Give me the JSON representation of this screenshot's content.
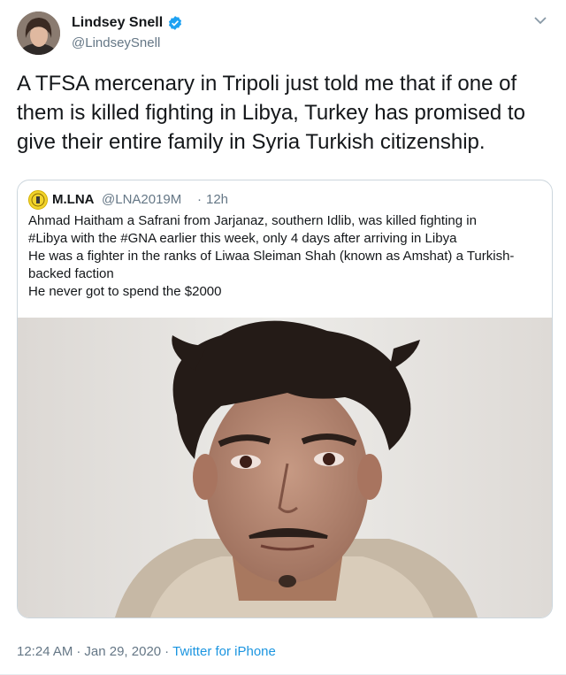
{
  "author": {
    "name": "Lindsey Snell",
    "handle": "@LindseySnell",
    "verified": true
  },
  "tweet": {
    "lines": [
      "A TFSA mercenary in Tripoli just told me that if one of",
      "them is killed fighting in Libya, Turkey has promised to",
      "give their entire family in Syria Turkish citizenship."
    ]
  },
  "quoted": {
    "name": "M.LNA",
    "handle": "@LNA2019M",
    "separator": "·",
    "time": "12h",
    "lines": [
      "Ahmad Haitham a Safrani from Jarjanaz, southern Idlib, was killed fighting in",
      "#Libya with the #GNA earlier this week, only 4 days after arriving in Libya",
      "He was a fighter in the ranks of Liwaa Sleiman Shah (known as Amshat) a Turkish-",
      "backed faction",
      "He never got to spend the $2000"
    ]
  },
  "meta": {
    "time": "12:24 AM",
    "separator1": "·",
    "date": "Jan 29, 2020",
    "separator2": "·",
    "source": "Twitter for iPhone"
  },
  "colors": {
    "verified": "#1da1f2",
    "link": "#1b95e0",
    "secondary_text": "#657786"
  }
}
